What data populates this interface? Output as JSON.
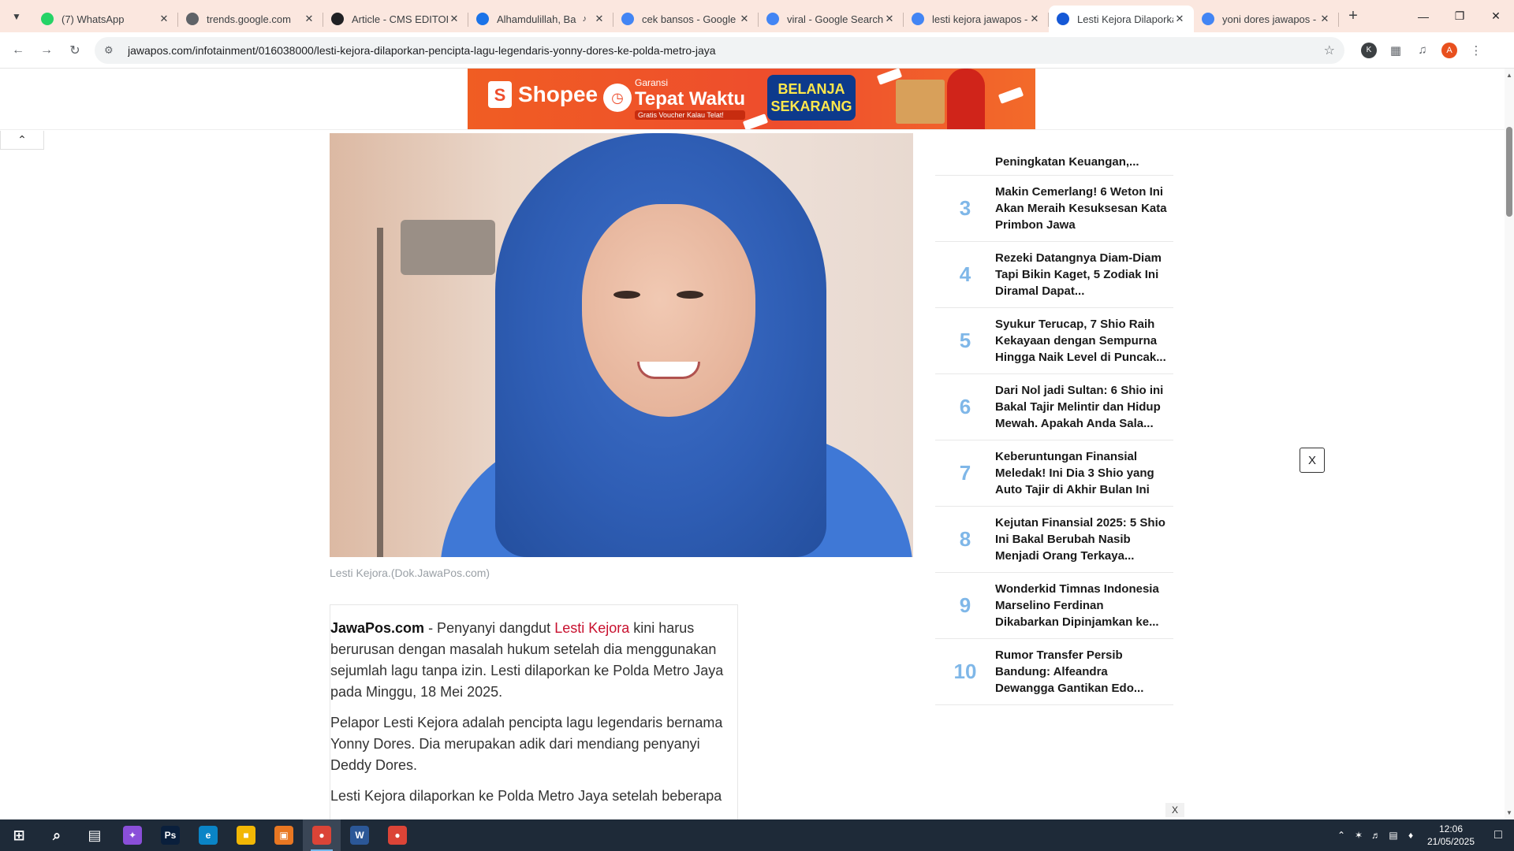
{
  "browser": {
    "tabs": [
      {
        "title": "(7) WhatsApp",
        "favicon": "whatsapp-icon",
        "color": "#25d366"
      },
      {
        "title": "trends.google.com",
        "favicon": "trends-icon",
        "color": "#5f6368"
      },
      {
        "title": "Article - CMS EDITOR",
        "favicon": "cms-icon",
        "color": "#202124"
      },
      {
        "title": "Alhamdulillah, Ba",
        "favicon": "doc-icon",
        "color": "#1a73e8"
      },
      {
        "title": "cek bansos - Google",
        "favicon": "google-icon",
        "color": "#4285f4"
      },
      {
        "title": "viral - Google Search",
        "favicon": "google-icon",
        "color": "#4285f4"
      },
      {
        "title": "lesti kejora jawapos -",
        "favicon": "google-icon",
        "color": "#4285f4"
      },
      {
        "title": "Lesti Kejora Dilaporka",
        "favicon": "jawapos-icon",
        "color": "#1558d6"
      },
      {
        "title": "yoni dores jawapos -",
        "favicon": "google-icon",
        "color": "#4285f4"
      }
    ],
    "url": "jawapos.com/infotainment/016038000/lesti-kejora-dilaporkan-pencipta-lagu-legendaris-yonny-dores-ke-polda-metro-jaya",
    "avatar_k": "K",
    "avatar_a": "A"
  },
  "ad": {
    "brand": "Shopee",
    "garansi_small": "Garansi",
    "garansi_big": "Tepat Waktu",
    "garansi_note": "Gratis Voucher Kalau Telat!",
    "cta": "BELANJA SEKARANG"
  },
  "article": {
    "caption": "Lesti Kejora.(Dok.JawaPos.com)",
    "p1_source": "JawaPos.com",
    "p1_a": " - Penyanyi dangdut ",
    "p1_link": "Lesti Kejora",
    "p1_b": " kini harus berurusan dengan masalah hukum setelah dia menggunakan sejumlah lagu tanpa izin. Lesti dilaporkan ke Polda Metro Jaya pada Minggu, 18 Mei 2025.",
    "p2": "Pelapor Lesti Kejora adalah pencipta lagu legendaris bernama Yonny Dores. Dia merupakan adik dari mendiang penyanyi Deddy Dores.",
    "p3": "Lesti Kejora dilaporkan ke Polda Metro Jaya setelah beberapa"
  },
  "sidebar": {
    "partial_title": "Peningkatan Keuangan,...",
    "items": [
      {
        "num": "3",
        "title": "Makin Cemerlang! 6 Weton Ini Akan Meraih Kesuksesan Kata Primbon Jawa"
      },
      {
        "num": "4",
        "title": "Rezeki Datangnya Diam-Diam Tapi Bikin Kaget, 5 Zodiak Ini Diramal Dapat..."
      },
      {
        "num": "5",
        "title": "Syukur Terucap, 7 Shio Raih Kekayaan dengan Sempurna Hingga Naik Level di Puncak..."
      },
      {
        "num": "6",
        "title": "Dari Nol jadi Sultan: 6 Shio ini Bakal Tajir Melintir dan Hidup Mewah. Apakah Anda Sala..."
      },
      {
        "num": "7",
        "title": "Keberuntungan Finansial Meledak! Ini Dia 3 Shio yang Auto Tajir di Akhir Bulan Ini"
      },
      {
        "num": "8",
        "title": "Kejutan Finansial 2025: 5 Shio Ini Bakal Berubah Nasib Menjadi Orang Terkaya..."
      },
      {
        "num": "9",
        "title": "Wonderkid Timnas Indonesia Marselino Ferdinan Dikabarkan Dipinjamkan ke..."
      },
      {
        "num": "10",
        "title": "Rumor Transfer Persib Bandung: Alfeandra Dewangga Gantikan Edo..."
      }
    ]
  },
  "overlay": {
    "close1": "X",
    "close2": "X"
  },
  "taskbar": {
    "apps": [
      "start-icon",
      "search-icon",
      "task-view-icon",
      "copilot-icon",
      "photoshop-icon",
      "edge-icon",
      "file-explorer-icon",
      "app-icon",
      "chrome-icon",
      "word-icon",
      "chrome-icon"
    ],
    "time": "12:06",
    "date": "21/05/2025"
  }
}
